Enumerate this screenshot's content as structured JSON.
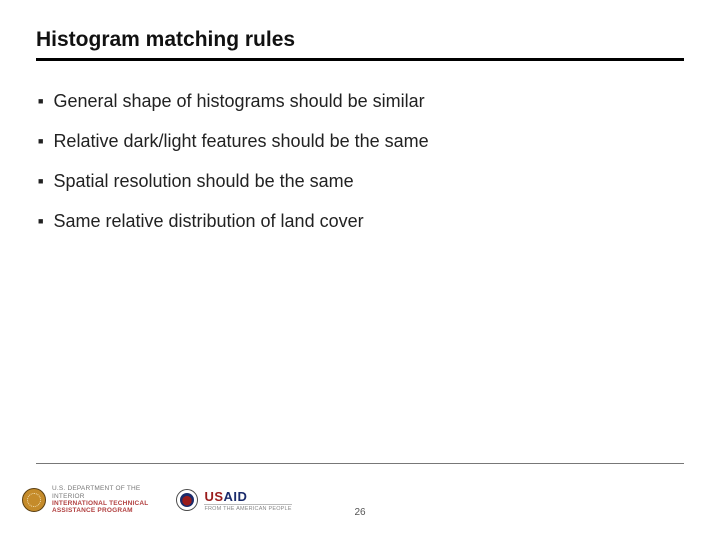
{
  "title": "Histogram matching rules",
  "bullets": [
    "General shape of histograms should be similar",
    "Relative dark/light features should be the same",
    "Spatial resolution should be the same",
    "Same relative distribution of land cover"
  ],
  "footer": {
    "doi": {
      "line1": "U.S. DEPARTMENT OF THE",
      "line2": "INTERIOR",
      "line3": "INTERNATIONAL TECHNICAL",
      "line4": "ASSISTANCE PROGRAM"
    },
    "usaid": {
      "main": "USAID",
      "sub": "FROM THE AMERICAN PEOPLE"
    }
  },
  "page_number": "26"
}
